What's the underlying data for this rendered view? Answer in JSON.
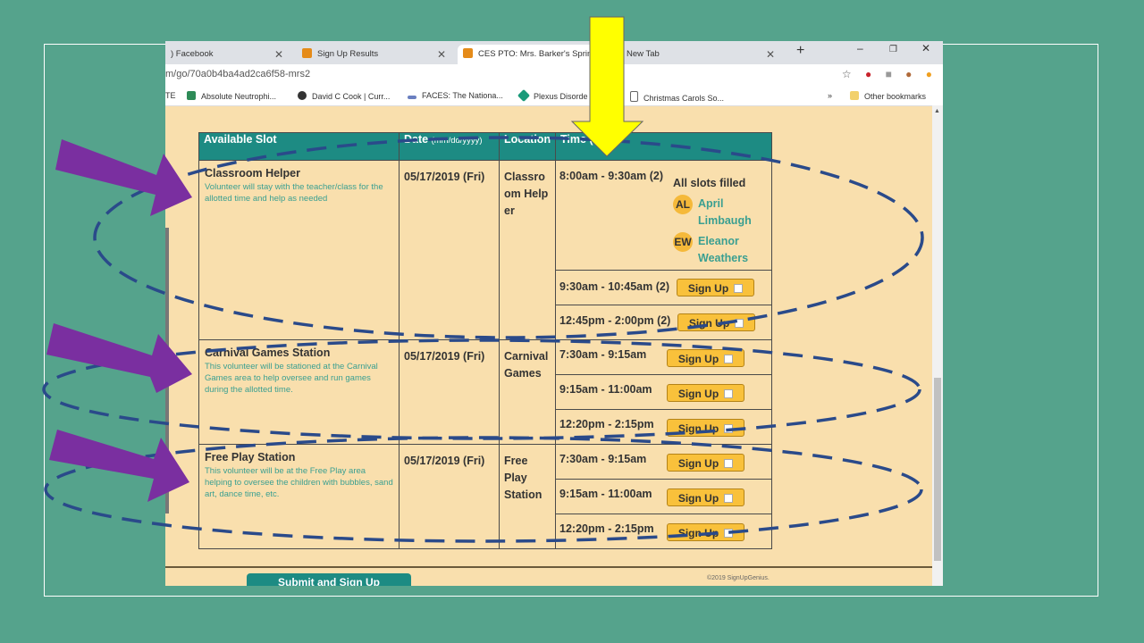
{
  "browser": {
    "tabs": [
      {
        "label": ") Facebook"
      },
      {
        "label": "Sign Up Results"
      },
      {
        "label": "CES PTO: Mrs. Barker's Spring"
      },
      {
        "label": "New Tab"
      }
    ],
    "url": "m/go/70a0b4ba4ad2ca6f58-mrs2",
    "bookmarks": [
      {
        "label": "TE"
      },
      {
        "label": "Absolute Neutrophi..."
      },
      {
        "label": "David C Cook | Curr..."
      },
      {
        "label": "FACES: The Nationa..."
      },
      {
        "label": "Plexus Disorde"
      },
      {
        "label": "Christmas Carols So..."
      },
      {
        "label": "»"
      },
      {
        "label": "Other bookmarks"
      }
    ]
  },
  "table": {
    "headers": {
      "slot": "Available Slot",
      "date": "Date",
      "date_hint": "(mm/dd/yyyy)",
      "location": "Location",
      "time": "Time (E"
    },
    "rows": [
      {
        "title": "Classroom Helper",
        "description": "Volunteer will stay with the teacher/class for the allotted time and help as needed",
        "date": "05/17/2019 (Fri)",
        "location": "Classroom Helper",
        "times": [
          {
            "time": "8:00am - 9:30am (2)",
            "filled_label": "All slots filled",
            "people": [
              {
                "initials": "AL",
                "name": "April Limbaugh"
              },
              {
                "initials": "EW",
                "name": "Eleanor Weathers"
              }
            ]
          },
          {
            "time": "9:30am - 10:45am (2)",
            "button": "Sign Up"
          },
          {
            "time": "12:45pm - 2:00pm (2)",
            "button": "Sign Up"
          }
        ]
      },
      {
        "title": "Carnival Games Station",
        "description": "This volunteer will be stationed at the Carnival Games area to help oversee and run games during the allotted time.",
        "date": "05/17/2019 (Fri)",
        "location": "Carnival Games",
        "times": [
          {
            "time": "7:30am - 9:15am",
            "button": "Sign Up"
          },
          {
            "time": "9:15am - 11:00am",
            "button": "Sign Up"
          },
          {
            "time": "12:20pm - 2:15pm",
            "button": "Sign Up"
          }
        ]
      },
      {
        "title": "Free Play Station",
        "description": "This volunteer will be at the Free Play area helping to oversee the children with bubbles, sand art, dance time, etc.",
        "date": "05/17/2019 (Fri)",
        "location": "Free Play Station",
        "times": [
          {
            "time": "7:30am - 9:15am",
            "button": "Sign Up"
          },
          {
            "time": "9:15am - 11:00am",
            "button": "Sign Up"
          },
          {
            "time": "12:20pm - 2:15pm",
            "button": "Sign Up"
          }
        ]
      }
    ]
  },
  "footer": {
    "submit_label": "Submit and Sign Up",
    "copyright": "©2019 SignUpGenius."
  },
  "colors": {
    "background": "#55a38c",
    "page": "#f9dfad",
    "header_teal": "#1d8b83",
    "button_yellow": "#f9c13b",
    "arrow_purple": "#7a2fa0",
    "arrow_yellow": "#ffff00",
    "ellipse_blue": "#2a4a8a"
  }
}
